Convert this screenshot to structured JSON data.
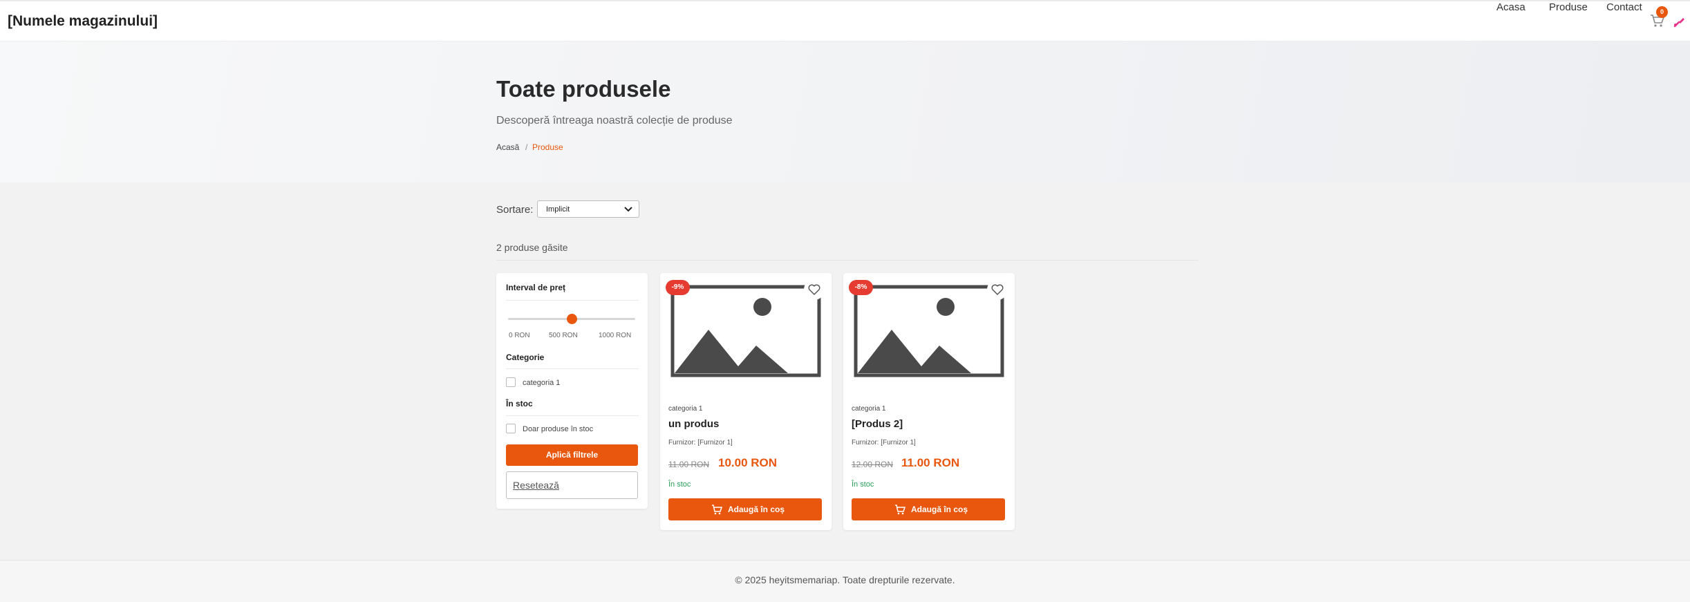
{
  "header": {
    "brand": "[Numele magazinului]",
    "nav": [
      "Acasa",
      "Produse",
      "Contact"
    ],
    "cart_count": "0",
    "accent_color": "#e8570d"
  },
  "hero": {
    "title": "Toate produsele",
    "subtitle": "Descoperă întreaga noastră colecție de produse",
    "breadcrumb": {
      "home": "Acasă",
      "separator": "/",
      "current": "Produse"
    }
  },
  "sort": {
    "label": "Sortare:",
    "value": "Implicit"
  },
  "results": {
    "count_text": "2 produse găsite"
  },
  "filters": {
    "price_heading": "Interval de preț",
    "price_slider_value": 0.5,
    "price_labels": [
      "0 RON",
      "500 RON",
      "1000 RON"
    ],
    "category_heading": "Categorie",
    "category_option": "categoria 1",
    "stock_heading": "În stoc",
    "stock_option": "Doar produse în stoc",
    "apply_label": "Aplică filtrele",
    "reset_label": "Resetează"
  },
  "products": [
    {
      "discount": "-9%",
      "category": "categoria 1",
      "name": "un produs",
      "supplier": "Furnizor: [Furnizor 1]",
      "old_price": "11.00 RON",
      "price": "10.00 RON",
      "stock": "În stoc",
      "add_label": "Adaugă în coș"
    },
    {
      "discount": "-8%",
      "category": "categoria 1",
      "name": "[Produs 2]",
      "supplier": "Furnizor: [Furnizor 1]",
      "old_price": "12.00 RON",
      "price": "11.00 RON",
      "stock": "În stoc",
      "add_label": "Adaugă în coș"
    }
  ],
  "footer": {
    "text": "© 2025 heyitsmemariap. Toate drepturile rezervate."
  }
}
